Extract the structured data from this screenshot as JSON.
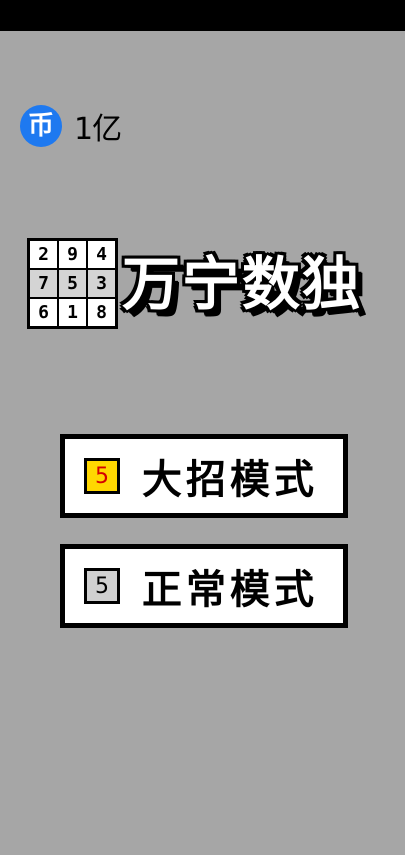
{
  "coins": {
    "icon_glyph": "币",
    "amount": "1亿",
    "icon_color": "#1e79f0"
  },
  "logo": {
    "cells": [
      "2",
      "9",
      "4",
      "7",
      "5",
      "3",
      "6",
      "1",
      "8"
    ]
  },
  "title": "万宁数独",
  "modes": {
    "big": {
      "label": "大招模式",
      "icon_digit": "5",
      "icon_bg": "#ffd700",
      "icon_digit_color": "#d40000"
    },
    "normal": {
      "label": "正常模式",
      "icon_digit": "5",
      "icon_bg": "#d0d0d0",
      "icon_digit_color": "#000000"
    }
  },
  "background_color": "#a6a6a6"
}
